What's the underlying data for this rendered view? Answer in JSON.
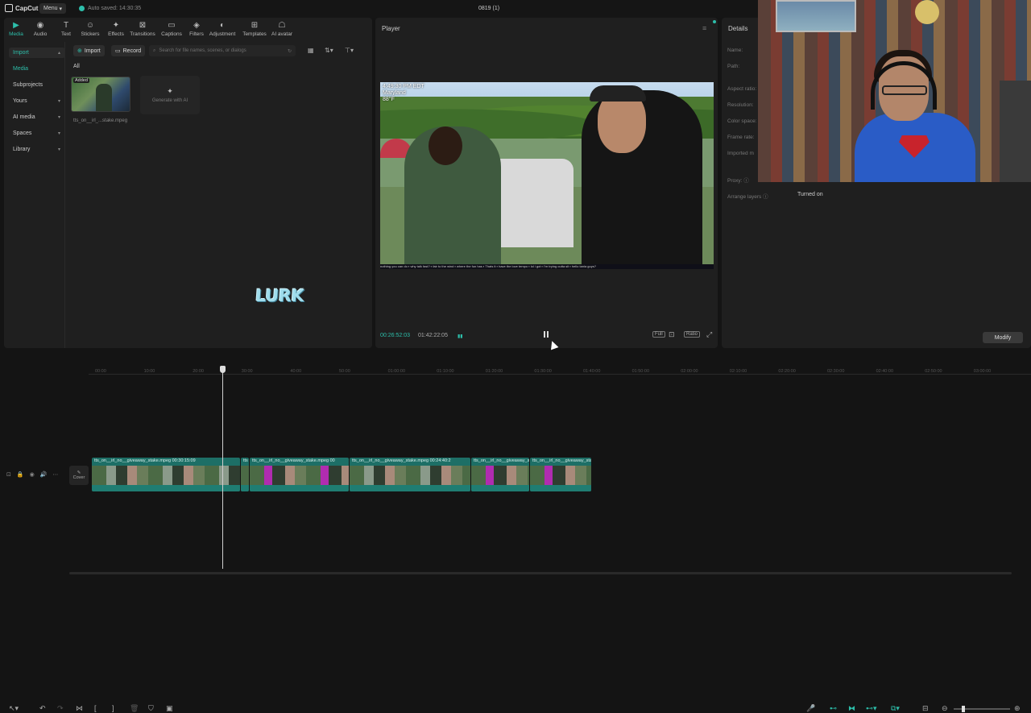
{
  "app": {
    "name": "CapCut",
    "menu_label": "Menu",
    "autosave": "Auto saved: 14:30:35",
    "project_title": "0819 (1)"
  },
  "toolbar": [
    {
      "label": "Media",
      "icon": "media-icon",
      "active": true
    },
    {
      "label": "Audio",
      "icon": "audio-icon"
    },
    {
      "label": "Text",
      "icon": "text-icon"
    },
    {
      "label": "Stickers",
      "icon": "stickers-icon"
    },
    {
      "label": "Effects",
      "icon": "effects-icon"
    },
    {
      "label": "Transitions",
      "icon": "transitions-icon"
    },
    {
      "label": "Captions",
      "icon": "captions-icon"
    },
    {
      "label": "Filters",
      "icon": "filters-icon"
    },
    {
      "label": "Adjustment",
      "icon": "adjustment-icon"
    },
    {
      "label": "Templates",
      "icon": "templates-icon"
    },
    {
      "label": "AI avatar",
      "icon": "ai-avatar-icon"
    }
  ],
  "sidebar": [
    {
      "label": "Import",
      "chevron": true,
      "selected": true
    },
    {
      "label": "Media",
      "highlight": true
    },
    {
      "label": "Subprojects"
    },
    {
      "label": "Yours",
      "chevron": true
    },
    {
      "label": "AI media",
      "chevron": true
    },
    {
      "label": "Spaces",
      "chevron": true
    },
    {
      "label": "Library",
      "chevron": true
    }
  ],
  "media": {
    "import_label": "Import",
    "record_label": "Record",
    "search_placeholder": "Search for file names, scenes, or dialogs",
    "filter_all": "All",
    "clip_badge": "Added",
    "clip_name": "tts_on__irl_...stake.mpeg",
    "generate_label": "Generate with AI",
    "sticker_text": "LURK"
  },
  "player": {
    "title": "Player",
    "current_time": "00:26:52:03",
    "total_time": "01:42:22:05",
    "overlay": [
      "4:49:30 PM EDT",
      "Maryland",
      "88°F"
    ],
    "ticker": "nothing you can do ▪ why talk fast? ▪ fair to the wind ▪ where the fun has ▪ Thats it ▪ have the love tempo ▪ lol i got ▪ I'm trying outta sit ▪ hello tania guys?",
    "ctrl_full": "Full",
    "ctrl_ratio": "Ratio"
  },
  "details": {
    "title": "Details",
    "rows": [
      "Name:",
      "Path:",
      "Aspect ratio:",
      "Resolution:",
      "Color space:",
      "Frame rate:",
      "Imported m"
    ],
    "proxy_label": "Proxy:",
    "arrange_label": "Arrange layers",
    "arrange_value": "Turned on",
    "modify_label": "Modify"
  },
  "timeline": {
    "ruler": [
      "00:00",
      "10:00",
      "20:00",
      "30:00",
      "40:00",
      "50:00",
      "01:00:00",
      "01:10:00",
      "01:20:00",
      "01:30:00",
      "01:40:00",
      "01:50:00",
      "02:00:00",
      "02:10:00",
      "02:20:00",
      "02:30:00",
      "02:40:00",
      "02:50:00",
      "03:00:00"
    ],
    "cover_label": "Cover",
    "clips": [
      {
        "label": "tts_on__irl_no__giveaway_stake.mpeg  00:30:15:09",
        "magenta": false
      },
      {
        "label": "tts",
        "magenta": false
      },
      {
        "label": "tts_on__irl_no__giveaway_stake.mpeg  00",
        "magenta": true
      },
      {
        "label": "tts_on__irl_no__giveaway_stake.mpeg  00:24:40:2",
        "magenta": false
      },
      {
        "label": "tts_on__irl_no__giveaway_stake.mpeg",
        "magenta": true
      },
      {
        "label": "tts_on__irl_no__giveaway_stake.mpeg",
        "magenta": true
      }
    ]
  },
  "colors": {
    "accent": "#2dbeaa",
    "background": "#141414",
    "panel": "#1f1f1f"
  }
}
